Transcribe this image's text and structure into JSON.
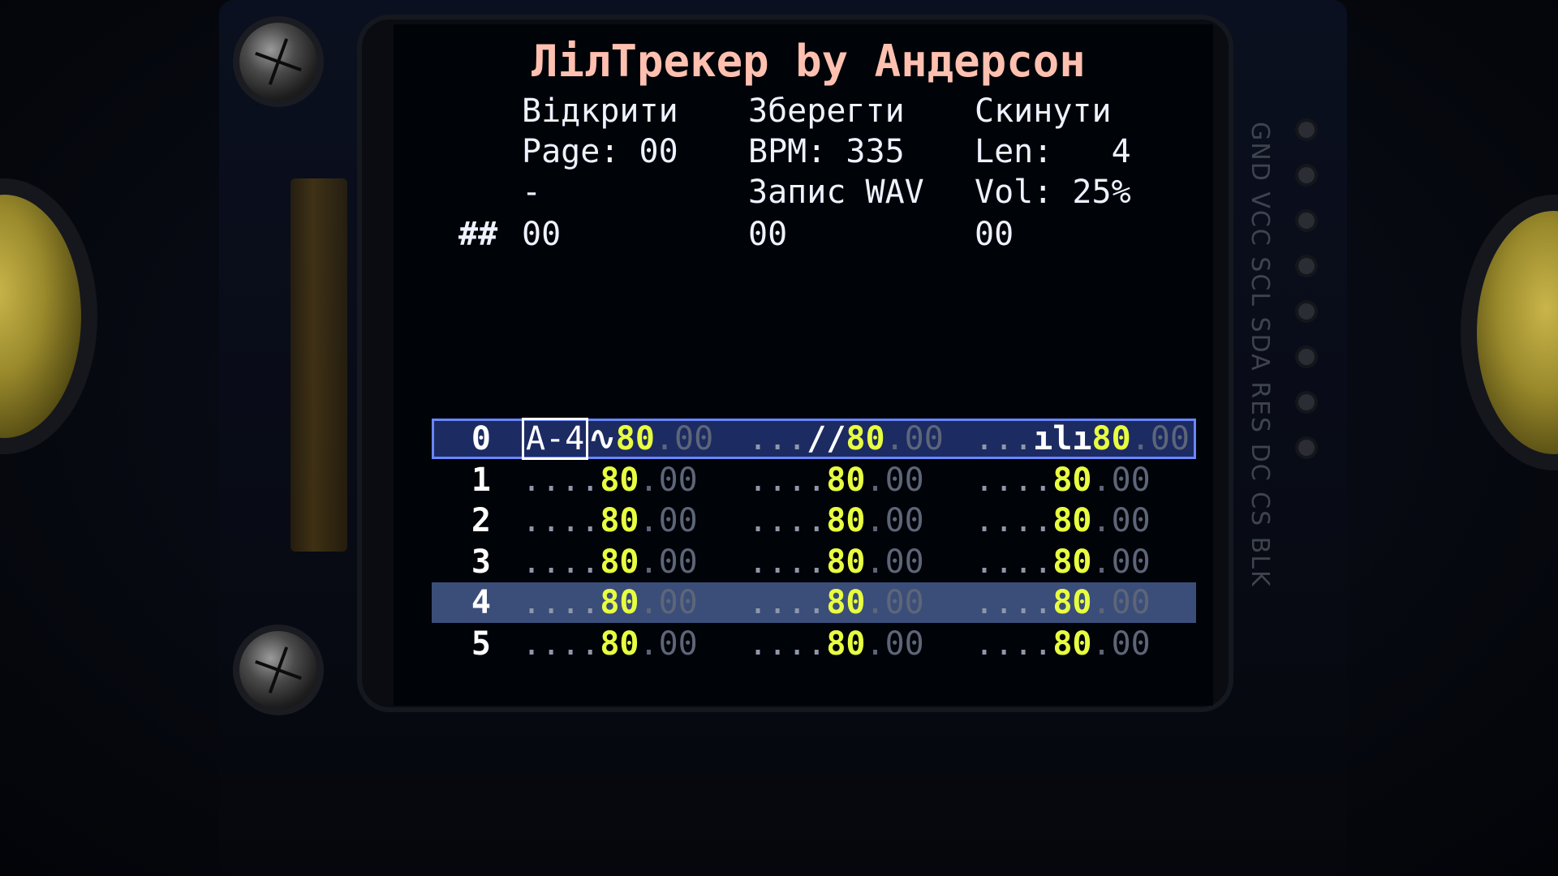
{
  "app": {
    "title": "ЛілТрекер by Андерсон"
  },
  "menu": {
    "open": "Відкрити",
    "save": "Зберегти",
    "reset": "Скинути",
    "page": "Page: 00",
    "bpm": "BPM: 335",
    "len": "Len:   4",
    "dash": "-",
    "record_wav": "Запис WAV",
    "vol": "Vol: 25%"
  },
  "header_row": {
    "hash": "##",
    "ch1": "00",
    "ch2": "00",
    "ch3": "00"
  },
  "pattern": {
    "selected_row": 0,
    "playing_row": 4,
    "rows": [
      {
        "num": "0",
        "ch": [
          {
            "note": "A-4",
            "wave_icon": "sine-wave-icon",
            "wave": "∿",
            "inst": "80",
            "fx": ".00"
          },
          {
            "note": "",
            "dots": "...",
            "wave_icon": "sawtooth-wave-icon",
            "wave": "∕∕",
            "inst": "80",
            "fx": ".00"
          },
          {
            "note": "",
            "dots": "...",
            "wave_icon": "noise-wave-icon",
            "wave": "ılı",
            "inst": "80",
            "fx": ".00"
          }
        ]
      },
      {
        "num": "1",
        "ch": [
          {
            "dots": "....",
            "inst": "80",
            "fx": ".00"
          },
          {
            "dots": "....",
            "inst": "80",
            "fx": ".00"
          },
          {
            "dots": "....",
            "inst": "80",
            "fx": ".00"
          }
        ]
      },
      {
        "num": "2",
        "ch": [
          {
            "dots": "....",
            "inst": "80",
            "fx": ".00"
          },
          {
            "dots": "....",
            "inst": "80",
            "fx": ".00"
          },
          {
            "dots": "....",
            "inst": "80",
            "fx": ".00"
          }
        ]
      },
      {
        "num": "3",
        "ch": [
          {
            "dots": "....",
            "inst": "80",
            "fx": ".00"
          },
          {
            "dots": "....",
            "inst": "80",
            "fx": ".00"
          },
          {
            "dots": "....",
            "inst": "80",
            "fx": ".00"
          }
        ]
      },
      {
        "num": "4",
        "ch": [
          {
            "dots": "....",
            "inst": "80",
            "fx": ".00"
          },
          {
            "dots": "....",
            "inst": "80",
            "fx": ".00"
          },
          {
            "dots": "....",
            "inst": "80",
            "fx": ".00"
          }
        ]
      },
      {
        "num": "5",
        "ch": [
          {
            "dots": "....",
            "inst": "80",
            "fx": ".00"
          },
          {
            "dots": "....",
            "inst": "80",
            "fx": ".00"
          },
          {
            "dots": "....",
            "inst": "80",
            "fx": ".00"
          }
        ]
      }
    ]
  },
  "board": {
    "silkscreen": "GND VCC SCL SDA RES DC CS BLK"
  },
  "colors": {
    "title": "#ffc0b0",
    "instrument": "#e8ff40",
    "selection_border": "#6a86ff",
    "playing_bar": "#3b4e7a"
  }
}
